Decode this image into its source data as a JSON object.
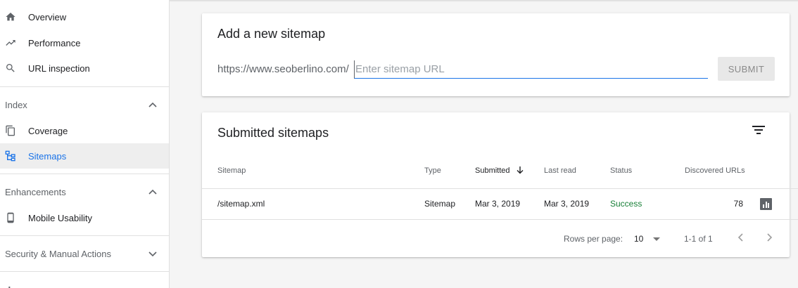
{
  "sidebar": {
    "top_items": [
      {
        "label": "Overview",
        "icon": "home-icon"
      },
      {
        "label": "Performance",
        "icon": "trending-up-icon"
      },
      {
        "label": "URL inspection",
        "icon": "search-icon"
      }
    ],
    "sections": {
      "index": {
        "title": "Index",
        "items": [
          {
            "label": "Coverage",
            "icon": "copy-pages-icon"
          },
          {
            "label": "Sitemaps",
            "icon": "sitemap-icon",
            "active": true
          }
        ]
      },
      "enhancements": {
        "title": "Enhancements",
        "items": [
          {
            "label": "Mobile Usability",
            "icon": "phone-icon"
          }
        ]
      },
      "security": {
        "title": "Security & Manual Actions"
      }
    }
  },
  "add_sitemap": {
    "title": "Add a new sitemap",
    "url_prefix": "https://www.seoberlino.com/",
    "input_placeholder": "Enter sitemap URL",
    "input_value": "",
    "submit_label": "SUBMIT"
  },
  "submitted": {
    "title": "Submitted sitemaps",
    "columns": {
      "sitemap": "Sitemap",
      "type": "Type",
      "submitted": "Submitted",
      "last_read": "Last read",
      "status": "Status",
      "discovered": "Discovered URLs"
    },
    "rows": [
      {
        "sitemap": "/sitemap.xml",
        "type": "Sitemap",
        "submitted": "Mar 3, 2019",
        "last_read": "Mar 3, 2019",
        "status": "Success",
        "discovered": "78"
      }
    ],
    "footer": {
      "rows_per_page_label": "Rows per page:",
      "rows_per_page_value": "10",
      "range": "1-1 of 1"
    }
  },
  "colors": {
    "accent": "#1a73e8",
    "success": "#188038",
    "text": "#202124",
    "muted": "#5f6368"
  }
}
